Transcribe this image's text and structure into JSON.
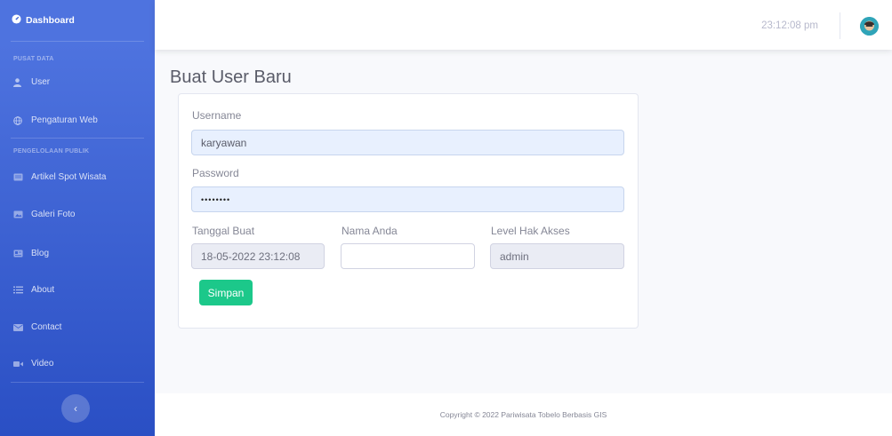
{
  "sidebar": {
    "brand": "Dashboard",
    "heading_1": "PUSAT DATA",
    "heading_2": "PENGELOLAAN PUBLIK",
    "items": [
      {
        "label": "User",
        "icon": "user-icon"
      },
      {
        "label": "Pengaturan Web",
        "icon": "globe-icon"
      },
      {
        "label": "Artikel Spot Wisata",
        "icon": "article-icon"
      },
      {
        "label": "Galeri Foto",
        "icon": "image-icon"
      },
      {
        "label": "Blog",
        "icon": "blog-icon"
      },
      {
        "label": "About",
        "icon": "list-icon"
      },
      {
        "label": "Contact",
        "icon": "envelope-icon"
      },
      {
        "label": "Video",
        "icon": "video-icon"
      }
    ],
    "toggle_symbol": "‹"
  },
  "topbar": {
    "time": "23:12:08 pm"
  },
  "page": {
    "title": "Buat User Baru"
  },
  "form": {
    "username_label": "Username",
    "username_value": "karyawan",
    "password_label": "Password",
    "password_value": "••••••••",
    "tanggal_label": "Tanggal Buat",
    "tanggal_value": "18-05-2022 23:12:08",
    "nama_label": "Nama Anda",
    "nama_value": "",
    "level_label": "Level Hak Akses",
    "level_value": "admin",
    "submit_label": "Simpan"
  },
  "footer": {
    "text": "Copyright © 2022 Pariwisata Tobelo Berbasis GIS"
  },
  "colors": {
    "sidebar_top": "#4e73df",
    "sidebar_bottom": "#2a4fc4",
    "success": "#1cc88a",
    "autofill": "#e8f0fe"
  }
}
